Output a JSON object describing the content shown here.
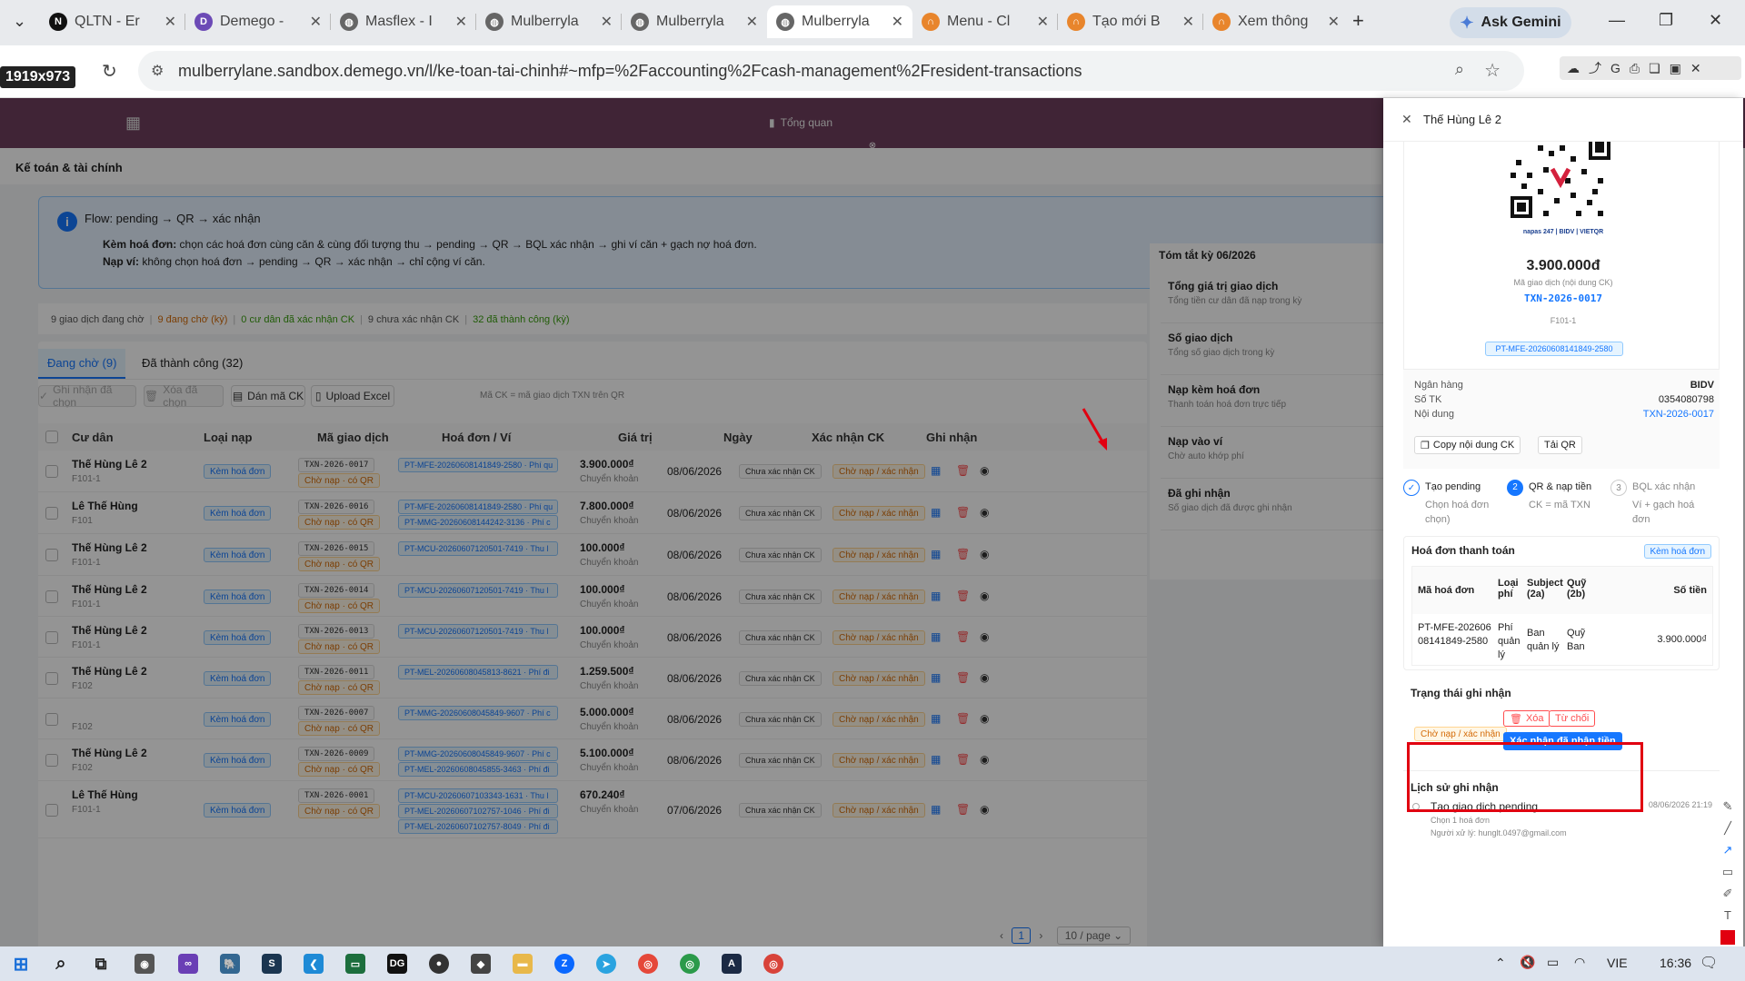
{
  "browser": {
    "tabs": [
      {
        "title": "QLTN - Er",
        "icon": "N",
        "color": "#000000"
      },
      {
        "title": "Demego -",
        "icon": "D",
        "color": "#6c4ab6"
      },
      {
        "title": "Masflex - I",
        "icon": "globe",
        "color": "#555555"
      },
      {
        "title": "Mulberryla",
        "icon": "globe",
        "color": "#555555"
      },
      {
        "title": "Mulberryla",
        "icon": "globe",
        "color": "#555555"
      },
      {
        "title": "Mulberryla",
        "icon": "globe",
        "color": "#555555"
      },
      {
        "title": "Menu - Cl",
        "icon": "arc",
        "color": "#e8852c"
      },
      {
        "title": "Tạo mới B",
        "icon": "arc",
        "color": "#e8852c"
      },
      {
        "title": "Xem thông",
        "icon": "arc",
        "color": "#e8852c"
      }
    ],
    "gemini": "Ask Gemini",
    "url": "mulberrylane.sandbox.demego.vn/l/ke-toan-tai-chinh#~mfp=%2Faccounting%2Fcash-management%2Fresident-transactions",
    "dim_badge": "1919x973"
  },
  "app": {
    "nav_center": "Tổng quan",
    "module_title": "Kế toán & tài chính",
    "flow": {
      "title": "Flow: pending → QR → xác nhận",
      "line1_label": "Kèm hoá đơn:",
      "line1_text": "chọn các hoá đơn cùng căn & cùng đối tượng thu → pending → QR → BQL xác nhận → ghi ví căn + gạch nợ hoá đơn.",
      "line2_label": "Nạp ví:",
      "line2_text": "không chọn hoá đơn → pending → QR → xác nhận → chỉ cộng ví căn."
    },
    "stats": [
      "9 giao dịch đang chờ",
      "|",
      "9 đang chờ (kỳ)",
      "|",
      "0 cư dân đã xác nhận CK",
      "|",
      "9 chưa xác nhận CK",
      "|",
      "32 đã thành công (kỳ)"
    ],
    "stat_colors": [
      "#555555",
      "#bbbbbb",
      "#d46b08",
      "#bbbbbb",
      "#389e0d",
      "#bbbbbb",
      "#555555",
      "#bbbbbb",
      "#389e0d"
    ],
    "tabs": [
      "Đang chờ (9)",
      "Đã thành công (32)"
    ],
    "toolbar": {
      "approve": "Ghi nhận đã chọn",
      "delete": "Xóa đã chọn",
      "paste": "Dán mã CK",
      "upload": "Upload Excel",
      "hint": "Mã CK = mã giao dịch TXN trên QR"
    },
    "columns": [
      "Cư dân",
      "Loại nạp",
      "Mã giao dịch",
      "Hoá đơn / Ví",
      "Giá trị",
      "Ngày",
      "Xác nhận CK",
      "Ghi nhận"
    ],
    "rows": [
      {
        "resident": "Thế Hùng Lê 2",
        "unit": "F101-1",
        "type": "Kèm hoá đơn",
        "txn": "TXN-2026-0017",
        "txn_status": "Chờ nạp · có QR",
        "invoices": [
          "PT-MFE-20260608141849-2580 · Phí qu"
        ],
        "amount": "3.900.000₫",
        "method": "Chuyển khoản",
        "date": "08/06/2026",
        "ck": "Chưa xác nhận CK",
        "record": "Chờ nạp / xác nhận"
      },
      {
        "resident": "Lê Thế Hùng",
        "unit": "F101",
        "type": "Kèm hoá đơn",
        "txn": "TXN-2026-0016",
        "txn_status": "Chờ nạp · có QR",
        "invoices": [
          "PT-MFE-20260608141849-2580 · Phí qu",
          "PT-MMG-20260608144242-3136 · Phí c"
        ],
        "amount": "7.800.000₫",
        "method": "Chuyển khoản",
        "date": "08/06/2026",
        "ck": "Chưa xác nhận CK",
        "record": "Chờ nạp / xác nhận"
      },
      {
        "resident": "Thế Hùng Lê 2",
        "unit": "F101-1",
        "type": "Kèm hoá đơn",
        "txn": "TXN-2026-0015",
        "txn_status": "Chờ nạp · có QR",
        "invoices": [
          "PT-MCU-20260607120501-7419 · Thu l"
        ],
        "amount": "100.000₫",
        "method": "Chuyển khoản",
        "date": "08/06/2026",
        "ck": "Chưa xác nhận CK",
        "record": "Chờ nạp / xác nhận"
      },
      {
        "resident": "Thế Hùng Lê 2",
        "unit": "F101-1",
        "type": "Kèm hoá đơn",
        "txn": "TXN-2026-0014",
        "txn_status": "Chờ nạp · có QR",
        "invoices": [
          "PT-MCU-20260607120501-7419 · Thu l"
        ],
        "amount": "100.000₫",
        "method": "Chuyển khoản",
        "date": "08/06/2026",
        "ck": "Chưa xác nhận CK",
        "record": "Chờ nạp / xác nhận"
      },
      {
        "resident": "Thế Hùng Lê 2",
        "unit": "F101-1",
        "type": "Kèm hoá đơn",
        "txn": "TXN-2026-0013",
        "txn_status": "Chờ nạp · có QR",
        "invoices": [
          "PT-MCU-20260607120501-7419 · Thu l"
        ],
        "amount": "100.000₫",
        "method": "Chuyển khoản",
        "date": "08/06/2026",
        "ck": "Chưa xác nhận CK",
        "record": "Chờ nạp / xác nhận"
      },
      {
        "resident": "Thế Hùng Lê 2",
        "unit": "F102",
        "type": "Kèm hoá đơn",
        "txn": "TXN-2026-0011",
        "txn_status": "Chờ nạp · có QR",
        "invoices": [
          "PT-MEL-20260608045813-8621 · Phí đi"
        ],
        "amount": "1.259.500₫",
        "method": "Chuyển khoản",
        "date": "08/06/2026",
        "ck": "Chưa xác nhận CK",
        "record": "Chờ nạp / xác nhận"
      },
      {
        "resident": "",
        "unit": "F102",
        "type": "Kèm hoá đơn",
        "txn": "TXN-2026-0007",
        "txn_status": "Chờ nạp · có QR",
        "invoices": [
          "PT-MMG-20260608045849-9607 · Phí c"
        ],
        "amount": "5.000.000₫",
        "method": "Chuyển khoản",
        "date": "08/06/2026",
        "ck": "Chưa xác nhận CK",
        "record": "Chờ nạp / xác nhận"
      },
      {
        "resident": "Thế Hùng Lê 2",
        "unit": "F102",
        "type": "Kèm hoá đơn",
        "txn": "TXN-2026-0009",
        "txn_status": "Chờ nạp · có QR",
        "invoices": [
          "PT-MMG-20260608045849-9607 · Phí c",
          "PT-MEL-20260608045855-3463 · Phí đi"
        ],
        "amount": "5.100.000₫",
        "method": "Chuyển khoản",
        "date": "08/06/2026",
        "ck": "Chưa xác nhận CK",
        "record": "Chờ nạp / xác nhận"
      },
      {
        "resident": "Lê Thế Hùng",
        "unit": "F101-1",
        "type": "Kèm hoá đơn",
        "txn": "TXN-2026-0001",
        "txn_status": "Chờ nạp · có QR",
        "invoices": [
          "PT-MCU-20260607103343-1631 · Thu l",
          "PT-MEL-20260607102757-1046 · Phí đi",
          "PT-MEL-20260607102757-8049 · Phí đi"
        ],
        "amount": "670.240₫",
        "method": "Chuyển khoản",
        "date": "07/06/2026",
        "ck": "Chưa xác nhận CK",
        "record": "Chờ nạp / xác nhận"
      }
    ],
    "pager": {
      "page": "1",
      "size": "10 / page"
    },
    "summary": {
      "title": "Tóm tắt kỳ 06/2026",
      "items": [
        {
          "title": "Tổng giá trị giao dịch",
          "desc": "Tổng tiền cư dân đã nạp trong kỳ"
        },
        {
          "title": "Số giao dịch",
          "desc": "Tổng số giao dịch trong kỳ"
        },
        {
          "title": "Nạp kèm hoá đơn",
          "desc": "Thanh toán hoá đơn trực tiếp"
        },
        {
          "title": "Nạp vào ví",
          "desc": "Chờ auto khớp phí"
        },
        {
          "title": "Đã ghi nhận",
          "desc": "Số giao dịch đã được ghi nhận"
        }
      ]
    }
  },
  "drawer": {
    "title": "Thế Hùng Lê 2",
    "qr_logos": "napas 247 | BIDV | VIETQR",
    "amount": "3.900.000đ",
    "amount_caption": "Mã giao dịch (nội dung CK)",
    "txn": "TXN-2026-0017",
    "unit": "F101-1",
    "invoice_tag": "PT-MFE-20260608141849-2580",
    "bank_rows": [
      {
        "k": "Ngân hàng",
        "v": "BIDV"
      },
      {
        "k": "Số TK",
        "v": "0354080798"
      },
      {
        "k": "Nội dung",
        "v": "TXN-2026-0017"
      }
    ],
    "copy_btn": "Copy nội dung CK",
    "qr_btn": "Tải QR",
    "steps": [
      {
        "n": "✓",
        "title": "Tạo pending",
        "desc": "Chọn hoá đơn chọn)"
      },
      {
        "n": "2",
        "title": "QR & nạp tiền",
        "desc": "CK = mã TXN"
      },
      {
        "n": "3",
        "title": "BQL xác nhận",
        "desc": "Ví + gạch hoá đơn"
      }
    ],
    "invoice_section": {
      "title": "Hoá đơn thanh toán",
      "tag": "Kèm hoá đơn",
      "headers": [
        "Mã hoá đơn",
        "Loại phí",
        "Subject (2a)",
        "Quỹ (2b)",
        "Số tiền"
      ],
      "row": [
        "PT-MFE-20260608141849-2580",
        "Phí quản lý",
        "Ban quản lý",
        "Quỹ Ban",
        "3.900.000₫"
      ]
    },
    "status_section": {
      "title": "Trạng thái ghi nhận",
      "tag": "Chờ nạp / xác nhận",
      "delete": "Xóa",
      "reject": "Từ chối",
      "confirm": "Xác nhận đã nhận tiền"
    },
    "history": {
      "title": "Lịch sử ghi nhận",
      "event": "Tạo giao dịch pending",
      "time": "08/06/2026 21:19",
      "detail": "Chọn 1 hoá đơn",
      "user": "Người xử lý: hunglt.0497@gmail.com"
    }
  },
  "taskbar": {
    "lang": "VIE",
    "time": "16:36"
  }
}
